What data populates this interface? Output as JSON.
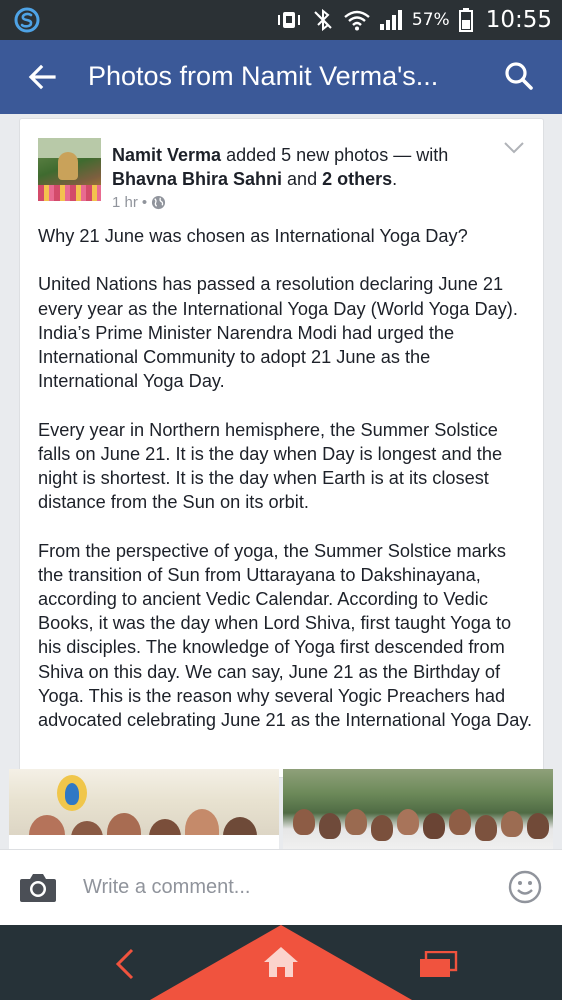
{
  "status_bar": {
    "battery_percent": "57%",
    "time": "10:55"
  },
  "app_bar": {
    "title": "Photos from Namit Verma's..."
  },
  "post": {
    "author": "Namit Verma",
    "action_text": " added 5 new photos — with ",
    "tagged_person": "Bhavna Bhira Sahni",
    "and_text": " and ",
    "others": "2 others",
    "period": ".",
    "time": "1 hr",
    "separator": "•",
    "paragraphs": [
      "Why 21 June was chosen as International Yoga Day?",
      "United Nations has passed a resolution declaring June 21 every year as the International Yoga Day (World Yoga Day). India’s Prime Minister Narendra Modi had urged the International Community to adopt 21 June as the International Yoga Day.",
      "Every year in Northern hemisphere, the Summer Solstice falls on June 21. It is the day when Day is longest and the night is shortest. It is the day when Earth is at its closest distance from the Sun on its orbit.",
      "From the perspective of yoga, the Summer Solstice marks the transition of Sun from Uttarayana to Dakshinayana, according to ancient Vedic Calendar. According to Vedic Books, it was the day when Lord Shiva, first taught Yoga to his disciples. The knowledge of Yoga first descended from Shiva on this day. We can say, June 21 as the Birthday of Yoga. This is the reason why several Yogic Preachers had advocated celebrating June 21 as the International Yoga Day."
    ]
  },
  "comment_bar": {
    "placeholder": "Write a comment..."
  },
  "colors": {
    "facebook_blue": "#3b5998",
    "nav_accent": "#f0533e",
    "status_bar": "#2b3135"
  },
  "icons": {
    "status": [
      "s-logo-icon",
      "vibrate-icon",
      "bluetooth-off-icon",
      "wifi-icon",
      "signal-icon",
      "battery-icon"
    ],
    "app_bar": [
      "back-arrow-icon",
      "search-icon"
    ],
    "comment_bar": [
      "camera-icon",
      "emoji-icon"
    ],
    "navigation": [
      "nav-back-icon",
      "home-icon",
      "recent-apps-icon"
    ]
  }
}
